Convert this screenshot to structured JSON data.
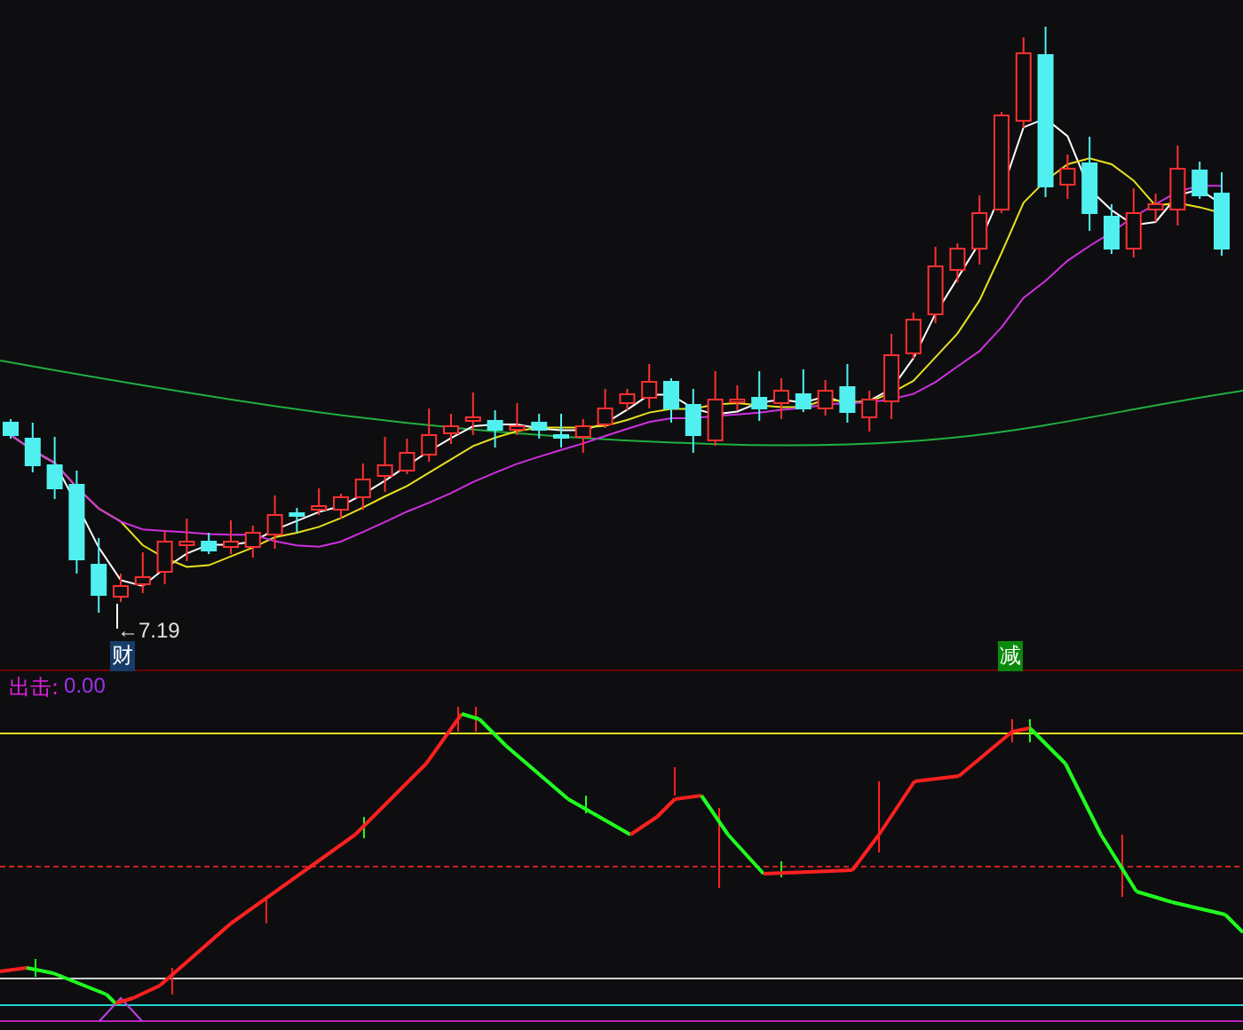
{
  "main_panel": {
    "low_marker": "←7.19",
    "signals": [
      {
        "label": "财",
        "kind": "buy"
      },
      {
        "label": "减",
        "kind": "sell"
      }
    ]
  },
  "indicator_panel": {
    "name": "出击:",
    "value": "0.00"
  }
}
